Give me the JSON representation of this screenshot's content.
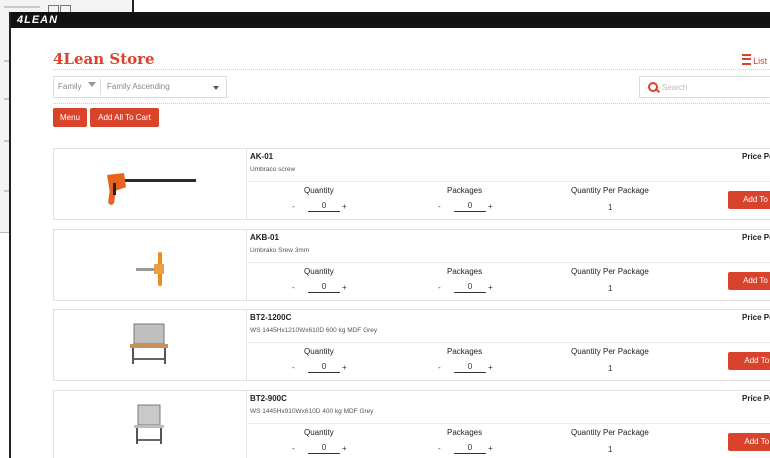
{
  "app": {
    "title": "4LEAN"
  },
  "store": {
    "title": "4Lean Store",
    "view_list_label": "List |"
  },
  "filters": {
    "family_label": "Family",
    "sort_value": "Family Ascending",
    "search_placeholder": "Search"
  },
  "toolbar": {
    "menu_label": "Menu",
    "add_all_label": "Add All To Cart"
  },
  "labels": {
    "quantity": "Quantity",
    "packages": "Packages",
    "qty_per_package": "Quantity Per Package",
    "minus": "-",
    "plus": "+"
  },
  "products": [
    {
      "code": "AK-01",
      "description": "Umbraco screw",
      "quantity": "0",
      "packages": "0",
      "qty_per_package": "1",
      "price_label": "Price Per",
      "add_label": "Add To Car"
    },
    {
      "code": "AKB-01",
      "description": "Umbrako Srew 3mm",
      "quantity": "0",
      "packages": "0",
      "qty_per_package": "1",
      "price_label": "Price Per",
      "add_label": "Add To Car"
    },
    {
      "code": "BT2-1200C",
      "description": "WS 1445Hx1210Wx610D 600 kg MDF Grey",
      "quantity": "0",
      "packages": "0",
      "qty_per_package": "1",
      "price_label": "Price Per U",
      "add_label": "Add To Ca"
    },
    {
      "code": "BT2-900C",
      "description": "WS 1445Hx910Wx610D 400 kg MDF Grey",
      "quantity": "0",
      "packages": "0",
      "qty_per_package": "1",
      "price_label": "Price Per U",
      "add_label": "Add To Ca"
    }
  ],
  "colors": {
    "accent": "#d9432b",
    "title_bar": "#111111"
  }
}
